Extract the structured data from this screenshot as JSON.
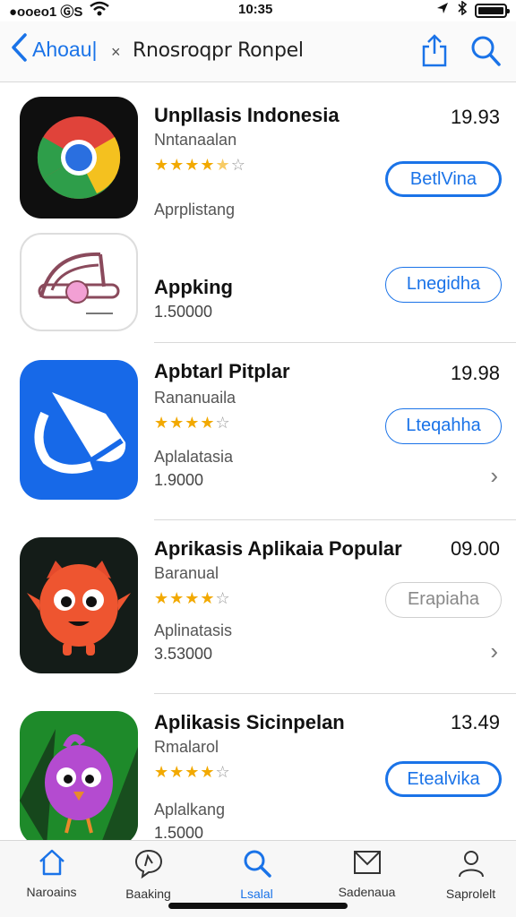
{
  "status_bar": {
    "carrier": "●ooeo1 ⒼS",
    "time": "10:35"
  },
  "nav": {
    "back_label": "Ahoau|",
    "separator": "×",
    "title": "Rnosroqpr Ronpel"
  },
  "apps": [
    {
      "name": "Unpllasis Indonesia",
      "developer": "Nntanaalan",
      "rating": 4.5,
      "stars": "★★★★",
      "half": "★",
      "empty": "☆",
      "category": "Aprplistang",
      "price": "19.93",
      "button": "BetlVina"
    },
    {
      "name": "Appking",
      "count": "1.50000",
      "button": "Lnegidha"
    },
    {
      "name": "Apbtarl Pitplar",
      "developer": "Rananuaila",
      "stars": "★★★★",
      "half": "",
      "empty": "☆",
      "category": "Aplalatasia",
      "count": "1.9000",
      "price": "19.98",
      "button": "Lteqahha"
    },
    {
      "name": "Aprikasis Aplikaia Popular",
      "developer": "Baranual",
      "stars": "★★★★",
      "half": "",
      "empty": "☆",
      "category": "Aplinatasis",
      "count": "3.53000",
      "price": "09.00",
      "button": "Erapiaha"
    },
    {
      "name": "Aplikasis Sicinpelan",
      "developer": "Rmalarol",
      "stars": "★★★★",
      "half": "",
      "empty": "☆",
      "category": "Aplalkang",
      "count": "1.5000",
      "price": "13.49",
      "button": "Etealvika"
    }
  ],
  "tabs": [
    {
      "label": "Naroains",
      "icon": "home-icon"
    },
    {
      "label": "Baaking",
      "icon": "speech-bubble-icon"
    },
    {
      "label": "Lsalal",
      "icon": "search-icon",
      "active": true
    },
    {
      "label": "Sadenaua",
      "icon": "mail-icon"
    },
    {
      "label": "Saprolelt",
      "icon": "person-icon"
    }
  ],
  "colors": {
    "accent": "#1a73e8",
    "star": "#f2a900"
  }
}
